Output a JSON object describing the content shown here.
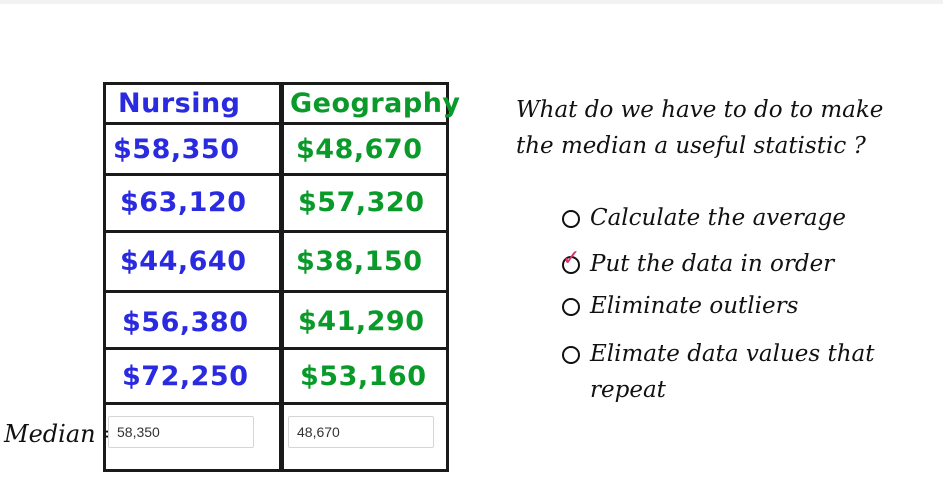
{
  "table": {
    "headers": {
      "nursing": "Nursing",
      "geography": "Geography"
    },
    "nursing": [
      "$58,350",
      "$63,120",
      "$44,640",
      "$56,380",
      "$72,250"
    ],
    "geography": [
      "$48,670",
      "$57,320",
      "$38,150",
      "$41,290",
      "$53,160"
    ]
  },
  "median": {
    "label": "Median =",
    "nursing_value": "58,350",
    "geography_value": "48,670"
  },
  "question": {
    "text": "What do we have to do to make the median a useful statistic ?",
    "options": [
      {
        "label": "Calculate the average",
        "checked": false
      },
      {
        "label": "Put the data in order",
        "checked": true
      },
      {
        "label": "Eliminate outliers",
        "checked": false
      },
      {
        "label": "Elimate data values that repeat",
        "checked": false
      }
    ],
    "check_mark": "✓"
  },
  "colors": {
    "nursing": "#2a2ae0",
    "geography": "#0a9a2a",
    "check": "#e0306a"
  }
}
